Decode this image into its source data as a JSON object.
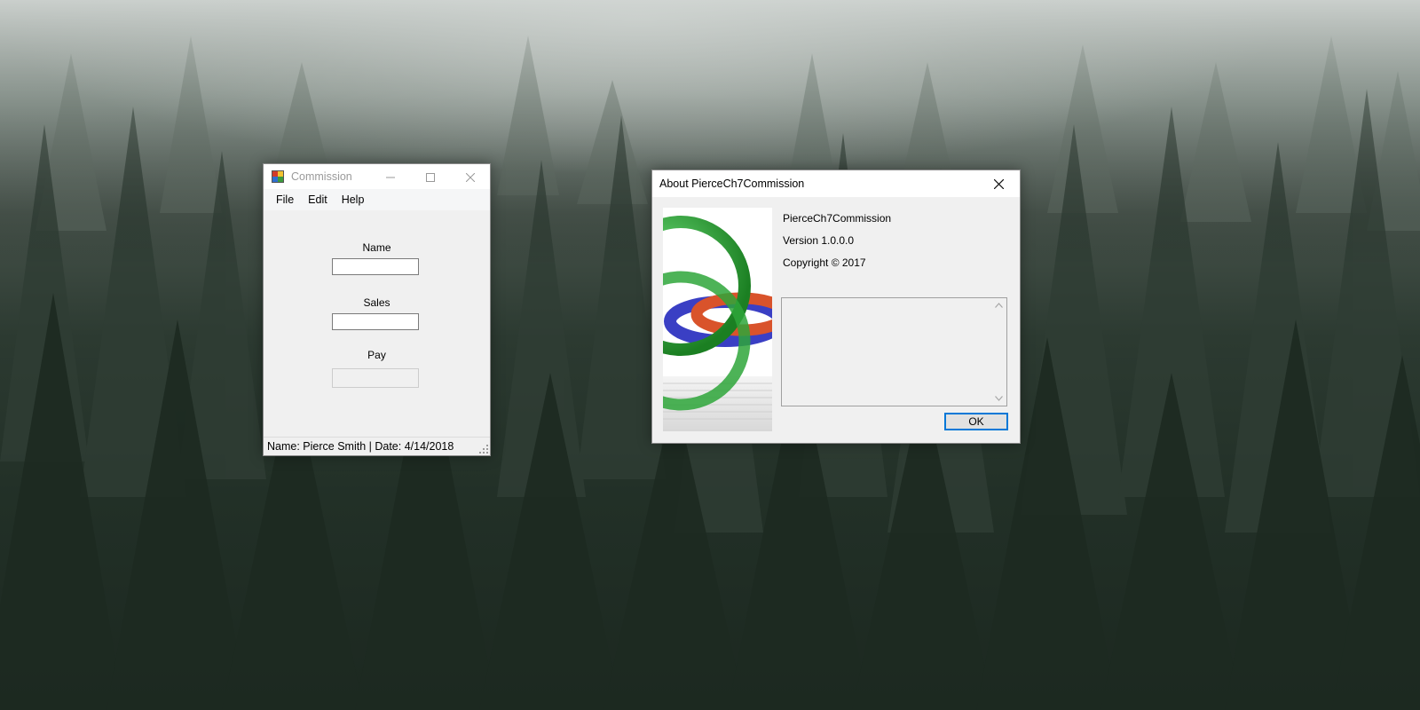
{
  "desktop": {
    "wallpaper": "misty pine forest"
  },
  "commission_window": {
    "title": "Commission",
    "menu": [
      "File",
      "Edit",
      "Help"
    ],
    "fields": {
      "name_label": "Name",
      "name_value": "",
      "sales_label": "Sales",
      "sales_value": "",
      "pay_label": "Pay",
      "pay_value": ""
    },
    "status": "Name: Pierce Smith | Date: 4/14/2018",
    "icons": [
      "app-icon",
      "minimize-icon",
      "maximize-icon",
      "close-icon",
      "resize-grip-icon"
    ]
  },
  "about_window": {
    "title": "About PierceCh7Commission",
    "product_name": "PierceCh7Commission",
    "version": "Version 1.0.0.0",
    "copyright": "Copyright ©  2017",
    "description": "",
    "ok_label": "OK",
    "colors": {
      "accent": "#0078d7",
      "ring_green": "#1f9a2a",
      "ring_red": "#d9532b",
      "ring_blue": "#3a3fc4"
    }
  }
}
